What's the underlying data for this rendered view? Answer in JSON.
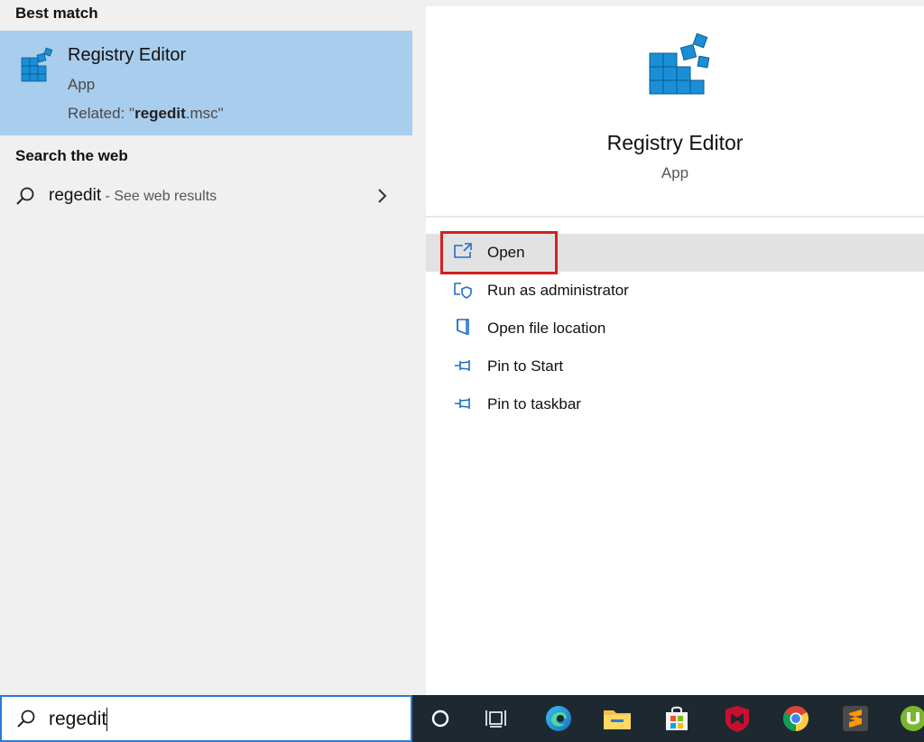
{
  "left": {
    "best_match_heading": "Best match",
    "best_match": {
      "title": "Registry Editor",
      "type": "App",
      "related_prefix": "Related: \"",
      "related_term": "regedit",
      "related_suffix": ".msc\""
    },
    "web_heading": "Search the web",
    "web_result": {
      "term": "regedit",
      "hint": " - See web results"
    }
  },
  "detail": {
    "title": "Registry Editor",
    "type": "App",
    "actions": [
      {
        "label": "Open",
        "icon": "open-window-icon"
      },
      {
        "label": "Run as administrator",
        "icon": "shield-admin-icon"
      },
      {
        "label": "Open file location",
        "icon": "file-location-icon"
      },
      {
        "label": "Pin to Start",
        "icon": "pin-icon"
      },
      {
        "label": "Pin to taskbar",
        "icon": "pin-icon"
      }
    ]
  },
  "search": {
    "value": "regedit"
  },
  "taskbar": {
    "icons": [
      "cortana-circle-icon",
      "task-view-icon",
      "edge-icon",
      "file-explorer-icon",
      "store-icon",
      "mcafee-icon",
      "chrome-icon",
      "sublime-icon",
      "utorrent-icon"
    ]
  },
  "colors": {
    "selected_bg": "#a9cdec",
    "accent": "#2d7ad6",
    "highlight_border": "#d42020",
    "taskbar_bg": "#1e2830"
  }
}
